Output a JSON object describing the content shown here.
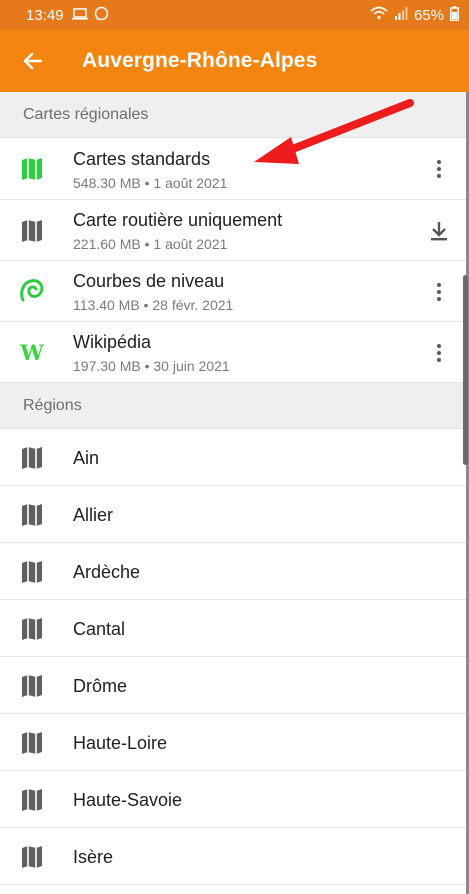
{
  "status_bar": {
    "time": "13:49",
    "battery_percent": "65%",
    "icons": [
      "laptop-icon",
      "whatsapp-icon",
      "wifi-icon",
      "signal-icon",
      "battery-icon"
    ]
  },
  "app_bar": {
    "back_icon": "arrow-left-icon",
    "title": "Auvergne-Rhône-Alpes"
  },
  "regional_maps": {
    "header": "Cartes régionales",
    "items": [
      {
        "name": "Cartes standards",
        "meta": "548.30 MB • 1 août 2021",
        "icon": "map-icon",
        "icon_color": "#2ecc40",
        "action": "more-vert-icon"
      },
      {
        "name": "Carte routière uniquement",
        "meta": "221.60 MB • 1 août 2021",
        "icon": "map-icon",
        "icon_color": "#5f5f5f",
        "action": "download-icon"
      },
      {
        "name": "Courbes de niveau",
        "meta": "113.40 MB • 28 févr. 2021",
        "icon": "contour-lines-icon",
        "icon_color": "#2ecc40",
        "action": "more-vert-icon"
      },
      {
        "name": "Wikipédia",
        "meta": "197.30 MB • 30 juin 2021",
        "icon": "wikipedia-icon",
        "icon_glyph": "W",
        "icon_color": "#3fd23f",
        "action": "more-vert-icon"
      }
    ]
  },
  "regions": {
    "header": "Régions",
    "items": [
      {
        "name": "Ain"
      },
      {
        "name": "Allier"
      },
      {
        "name": "Ardèche"
      },
      {
        "name": "Cantal"
      },
      {
        "name": "Drôme"
      },
      {
        "name": "Haute-Loire"
      },
      {
        "name": "Haute-Savoie"
      },
      {
        "name": "Isère"
      }
    ]
  },
  "colors": {
    "accent": "#f4850e",
    "status_bar": "#e6791a",
    "annotation_arrow": "#ee1c1c"
  }
}
